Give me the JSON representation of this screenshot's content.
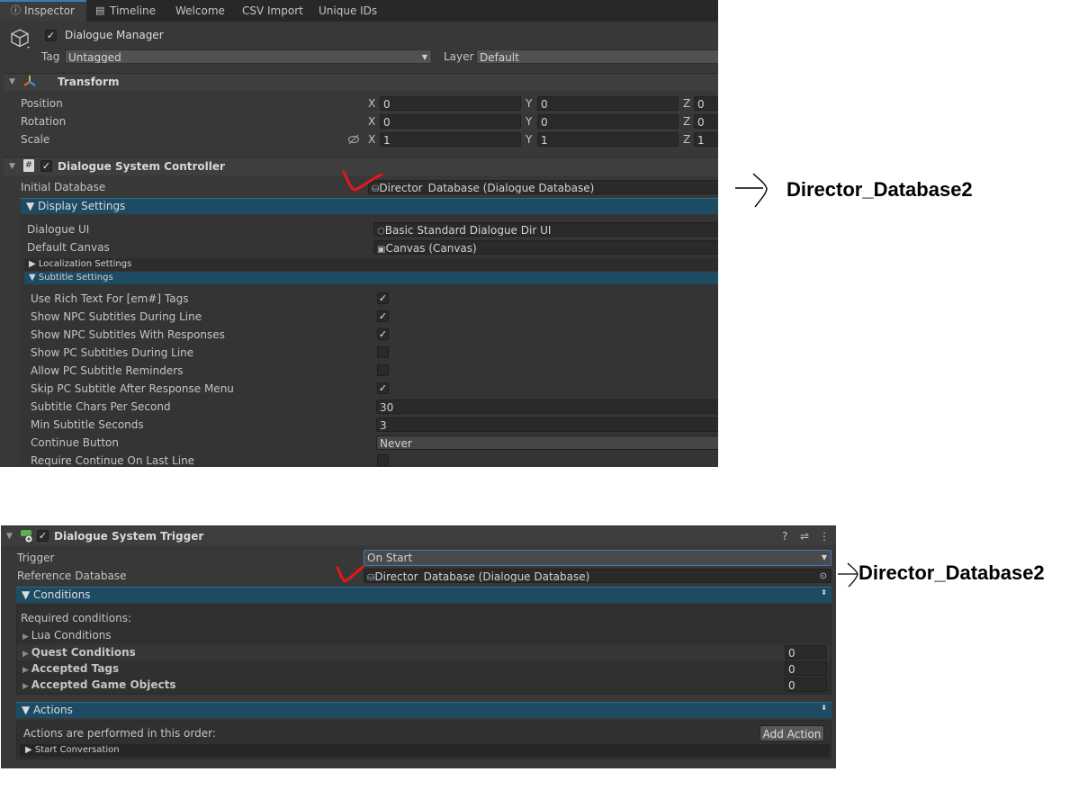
{
  "inspector": {
    "tabs": [
      "Inspector",
      "Timeline",
      "Welcome",
      "CSV Import",
      "Unique IDs"
    ],
    "object_name": "Dialogue Manager",
    "tag_label": "Tag",
    "tag_value": "Untagged",
    "layer_label": "Layer",
    "layer_value": "Default",
    "transform": {
      "title": "Transform",
      "rows": [
        {
          "label": "Position",
          "x": "0",
          "y": "0",
          "z": "0"
        },
        {
          "label": "Rotation",
          "x": "0",
          "y": "0",
          "z": "0"
        },
        {
          "label": "Scale",
          "x": "1",
          "y": "1",
          "z": "1"
        }
      ],
      "axis_x": "X",
      "axis_y": "Y",
      "axis_z": "Z"
    },
    "controller": {
      "title": "Dialogue System Controller",
      "initial_db_label": "Initial Database",
      "initial_db_value": "Director_Database (Dialogue Database)",
      "display_settings": "▼ Display Settings",
      "dialogue_ui_label": "Dialogue UI",
      "dialogue_ui_value": "Basic Standard Dialogue Dir UI",
      "default_canvas_label": "Default Canvas",
      "default_canvas_value": "Canvas (Canvas)",
      "localization_settings": "▶ Localization Settings",
      "subtitle_settings": "▼ Subtitle Settings",
      "subtitle_rows": [
        {
          "label": "Use Rich Text For [em#] Tags",
          "checked": true
        },
        {
          "label": "Show NPC Subtitles During Line",
          "checked": true
        },
        {
          "label": "Show NPC Subtitles With Responses",
          "checked": true
        },
        {
          "label": "Show PC Subtitles During Line",
          "checked": false
        },
        {
          "label": "Allow PC Subtitle Reminders",
          "checked": false
        },
        {
          "label": "Skip PC Subtitle After Response Menu",
          "checked": true
        }
      ],
      "chars_per_second_label": "Subtitle Chars Per Second",
      "chars_per_second_value": "30",
      "min_seconds_label": "Min Subtitle Seconds",
      "min_seconds_value": "3",
      "continue_button_label": "Continue Button",
      "continue_button_value": "Never",
      "require_continue_label": "Require Continue On Last Line"
    }
  },
  "trigger": {
    "title": "Dialogue System Trigger",
    "trigger_label": "Trigger",
    "trigger_value": "On Start",
    "ref_db_label": "Reference Database",
    "ref_db_value": "Director_Database (Dialogue Database)",
    "conditions": "▼ Conditions",
    "required_conditions": "Required conditions:",
    "lua_conditions": "Lua Conditions",
    "quest_conditions": "Quest Conditions",
    "quest_value": "0",
    "accepted_tags": "Accepted Tags",
    "tags_value": "0",
    "accepted_objects": "Accepted Game Objects",
    "objects_value": "0",
    "actions": "▼ Actions",
    "actions_order": "Actions are performed in this order:",
    "add_action": "Add Action",
    "start_conversation": "▶ Start Conversation"
  },
  "annotations": {
    "top": "Director_Database2",
    "bottom": "Director_Database2"
  },
  "colors": {
    "panel_bg": "#383838",
    "foldout_blue": "#1d4b64",
    "annotation_red": "#e8161b"
  }
}
